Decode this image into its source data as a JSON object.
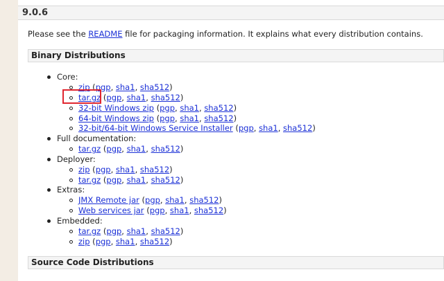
{
  "version": "9.0.6",
  "intro": {
    "before": "Please see the ",
    "link": "README",
    "after": " file for packaging information. It explains what every distribution contains."
  },
  "sections": {
    "binary": "Binary Distributions",
    "source": "Source Code Distributions"
  },
  "core": {
    "label": "Core:",
    "zip": {
      "name": "zip",
      "pgp": "pgp",
      "sha1": "sha1",
      "sha512": "sha512"
    },
    "targz": {
      "name": "tar.gz",
      "pgp": "pgp",
      "sha1": "sha1",
      "sha512": "sha512"
    },
    "win32": {
      "name": "32-bit Windows zip",
      "pgp": "pgp",
      "sha1": "sha1",
      "sha512": "sha512"
    },
    "win64": {
      "name": "64-bit Windows zip",
      "pgp": "pgp",
      "sha1": "sha1",
      "sha512": "sha512"
    },
    "installer": {
      "name": "32-bit/64-bit Windows Service Installer",
      "pgp": "pgp",
      "sha1": "sha1",
      "sha512": "sha512"
    }
  },
  "fulldoc": {
    "label": "Full documentation:",
    "targz": {
      "name": "tar.gz",
      "pgp": "pgp",
      "sha1": "sha1",
      "sha512": "sha512"
    }
  },
  "deployer": {
    "label": "Deployer:",
    "zip": {
      "name": "zip",
      "pgp": "pgp",
      "sha1": "sha1",
      "sha512": "sha512"
    },
    "targz": {
      "name": "tar.gz",
      "pgp": "pgp",
      "sha1": "sha1",
      "sha512": "sha512"
    }
  },
  "extras": {
    "label": "Extras:",
    "jmx": {
      "name": "JMX Remote jar",
      "pgp": "pgp",
      "sha1": "sha1",
      "sha512": "sha512"
    },
    "ws": {
      "name": "Web services jar",
      "pgp": "pgp",
      "sha1": "sha1",
      "sha512": "sha512"
    }
  },
  "embedded": {
    "label": "Embedded:",
    "targz": {
      "name": "tar.gz",
      "pgp": "pgp",
      "sha1": "sha1",
      "sha512": "sha512"
    },
    "zip": {
      "name": "zip",
      "pgp": "pgp",
      "sha1": "sha1",
      "sha512": "sha512"
    }
  },
  "punct": {
    "open": " (",
    "comma": ", ",
    "close": ")"
  }
}
